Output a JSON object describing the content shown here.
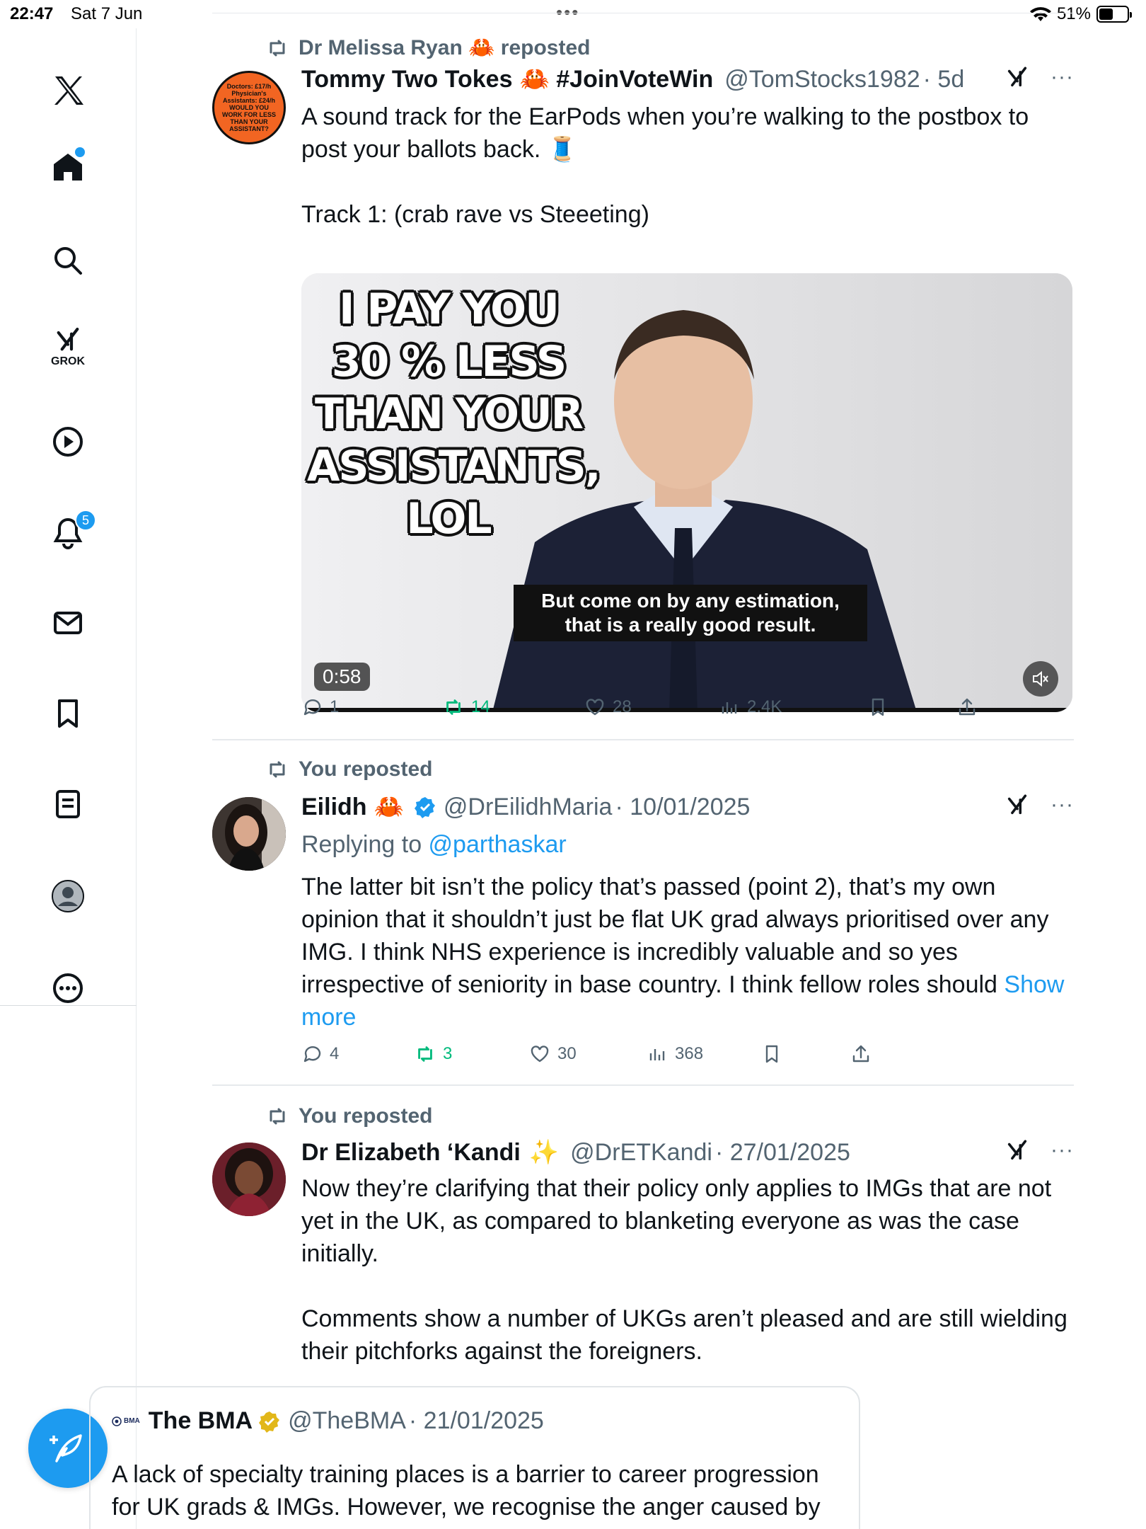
{
  "status_bar": {
    "time": "22:47",
    "date": "Sat 7 Jun",
    "dots": "•••",
    "battery": "51%",
    "battery_level": 0.51
  },
  "sidebar": {
    "items": [
      {
        "name": "x-logo-icon"
      },
      {
        "name": "home-icon",
        "notification_dot": true
      },
      {
        "name": "search-icon"
      },
      {
        "name": "grok-icon",
        "label": "GROK"
      },
      {
        "name": "video-icon"
      },
      {
        "name": "notifications-icon",
        "badge": "5"
      },
      {
        "name": "messages-icon"
      },
      {
        "name": "bookmarks-icon"
      },
      {
        "name": "lists-icon"
      },
      {
        "name": "profile-icon"
      },
      {
        "name": "more-icon"
      }
    ],
    "compose_icon": "compose-post-icon"
  },
  "posts": [
    {
      "repost_label": "Dr Melissa Ryan 🦀 reposted",
      "avatar_text": "Doctors: £17/h Physician's Assistants: £24/h WOULD YOU WORK FOR LESS THAN YOUR ASSISTANT?",
      "author": "Tommy Two Tokes",
      "author_suffix": "🦀 #JoinVoteWin",
      "handle": "@TomStocks1982",
      "time": "· 5d",
      "body": [
        "A sound track for the EarPods when you’re walking to the postbox to post your ballots back. 🧵",
        "Track 1: (crab rave vs Steeeting)"
      ],
      "video": {
        "meme_text": "I PAY YOU 30 % LESS THAN YOUR ASSISTANTS, LOL",
        "caption": "But come on by any estimation, that is a really good result.",
        "duration": "0:58"
      },
      "stats": {
        "replies": "1",
        "reposts": "14",
        "likes": "28",
        "views": "2.4K"
      }
    },
    {
      "repost_label": "You reposted",
      "author": "Eilidh",
      "handle": "@DrEilidhMaria",
      "time": "· 10/01/2025",
      "reply_prefix": "Replying to ",
      "reply_handle": "@parthaskar",
      "body": "The latter bit isn’t the policy that’s passed (point 2), that’s my own opinion that it shouldn’t just be flat UK grad always prioritised over any IMG. I think NHS experience is incredibly valuable and so yes irrespective of seniority in base country. I think fellow roles should ",
      "show_more": "Show more",
      "stats": {
        "replies": "4",
        "reposts": "3",
        "likes": "30",
        "views": "368"
      }
    },
    {
      "repost_label": "You reposted",
      "author": "Dr Elizabeth ‘Kandi",
      "author_suffix": "✨",
      "handle": "@DrETKandi",
      "time": "· 27/01/2025",
      "body": [
        "Now they’re clarifying that their policy only applies to IMGs that are not yet in the UK, as compared to blanketing everyone as was the case initially.",
        "Comments show a number of UKGs aren’t pleased and are still wielding their pitchforks against the foreigners."
      ],
      "quote": {
        "logo_text": "BMA",
        "author": "The BMA",
        "handle": "@TheBMA",
        "time": "· 21/01/2025",
        "body": "A lack of specialty training places is a barrier to career progression for UK grads & IMGs. However, we recognise the anger caused by the previous RDC communication on how to address this"
      }
    }
  ],
  "colors": {
    "accent": "#1d9bf0",
    "repost_green": "#00ba7c",
    "secondary": "#536471",
    "gold_check": "#e2b719"
  }
}
